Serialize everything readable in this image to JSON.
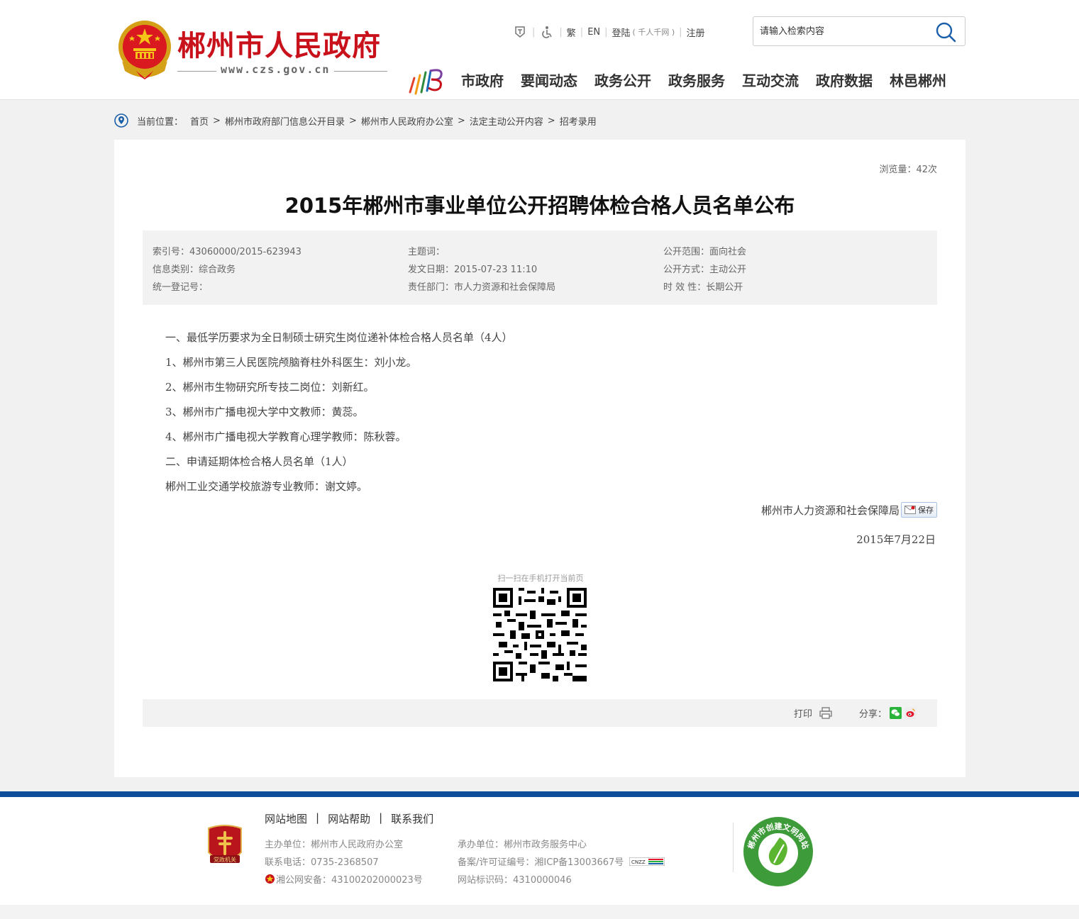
{
  "header": {
    "site_name": "郴州市人民政府",
    "site_domain": "www.czs.gov.cn",
    "toolbar": {
      "traditional": "繁",
      "english": "EN",
      "login": "登陆",
      "login_note": "( 千人千网 )",
      "register": "注册"
    },
    "search": {
      "placeholder": "请输入检索内容"
    },
    "nav": [
      "市政府",
      "要闻动态",
      "政务公开",
      "政务服务",
      "互动交流",
      "政府数据",
      "林邑郴州"
    ]
  },
  "breadcrumb": {
    "label": "当前位置：",
    "items": [
      "首页",
      "郴州市政府部门信息公开目录",
      "郴州市人民政府办公室",
      "法定主动公开内容",
      "招考录用"
    ],
    "separator": ">"
  },
  "article": {
    "views": "浏览量：42次",
    "title": "2015年郴州市事业单位公开招聘体检合格人员名单公布",
    "meta": {
      "index_no": "索引号：43060000/2015-623943",
      "subject": "主题词：",
      "scope": "公开范围：面向社会",
      "category": "信息类别：综合政务",
      "date": "发文日期：2015-07-23 11:10",
      "method": "公开方式：主动公开",
      "reg_no": "统一登记号：",
      "dept": "责任部门：市人力资源和社会保障局",
      "validity": "时 效 性：长期公开"
    },
    "paragraphs": [
      "一、最低学历要求为全日制硕士研究生岗位递补体检合格人员名单（4人）",
      "1、郴州市第三人民医院颅脑脊柱外科医生：刘小龙。",
      "2、郴州市生物研究所专技二岗位：刘新红。",
      "3、郴州市广播电视大学中文教师：黄蕊。",
      "4、郴州市广播电视大学教育心理学教师：陈秋蓉。",
      "二、申请延期体检合格人员名单（1人）",
      "郴州工业交通学校旅游专业教师：谢文婷。"
    ],
    "signature": "郴州市人力资源和社会保障局",
    "save_label": "保存",
    "sign_date": "2015年7月22日",
    "qr_caption": "扫一扫在手机打开当前页",
    "print_label": "打印",
    "share_label": "分享："
  },
  "footer": {
    "links": [
      "网站地图",
      "网站帮助",
      "联系我们"
    ],
    "link_separator": "|",
    "sponsor": "主办单位：郴州市人民政府办公室",
    "phone": "联系电话：0735-2368507",
    "police": "湘公网安备：43100202000023号",
    "organizer": "承办单位：郴州市政务服务中心",
    "icp": "备案/许可证编号：湘ICP备13003667号",
    "site_code": "网站标识码：4310000046",
    "party_badge_text": "党政机关",
    "civic_badge_text": "郴州市创建文明网站"
  },
  "colors": {
    "brand_red": "#c8111a",
    "footer_blue": "#0f4d98"
  },
  "icons": [
    "emblem-icon",
    "barrier-free-icon",
    "accessibility-icon",
    "search-icon",
    "location-icon",
    "print-icon",
    "wechat-icon",
    "weibo-icon",
    "save-mail-icon",
    "qr-code"
  ]
}
